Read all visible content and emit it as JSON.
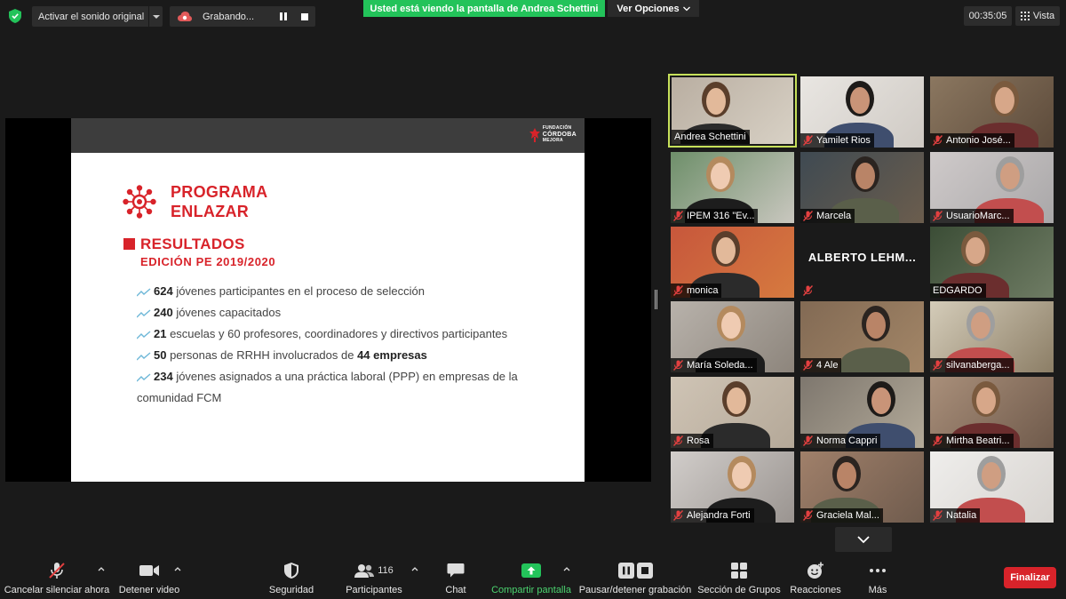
{
  "topbar": {
    "audio_button": "Activar el sonido original",
    "recording_label": "Grabando...",
    "viewing_banner": "Usted está viendo la pantalla de Andrea Schettini",
    "view_options": "Ver Opciones",
    "timer": "00:35:05",
    "view_label": "Vista"
  },
  "slide": {
    "brand_line1": "FUNDACIÓN",
    "brand_line2": "CÓRDOBA",
    "brand_line3": "MEJORA",
    "program_title_1": "PROGRAMA",
    "program_title_2": "ENLAZAR",
    "results_title": "RESULTADOS",
    "results_subtitle": "EDICIÓN PE 2019/2020",
    "bullets": [
      {
        "num": "624",
        "text": " jóvenes participantes en el proceso de selección"
      },
      {
        "num": "240",
        "text": " jóvenes capacitados"
      },
      {
        "num": "21",
        "text": " escuelas y 60 profesores, coordinadores y directivos  participantes"
      },
      {
        "num": "50",
        "text": " personas de RRHH involucrados de ",
        "bold_tail": "44 empresas"
      },
      {
        "num": "234",
        "text": " jóvenes asignados a una práctica laboral (PPP) en empresas de la comunidad FCM"
      }
    ]
  },
  "participants": [
    {
      "name": "Andrea Schettini",
      "muted": false,
      "active": true
    },
    {
      "name": "Yamilet Rios",
      "muted": true
    },
    {
      "name": "Antonio José...",
      "muted": true
    },
    {
      "name": "IPEM 316 \"Ev...",
      "muted": true
    },
    {
      "name": "Marcela",
      "muted": true
    },
    {
      "name": "UsuarioMarc...",
      "muted": true
    },
    {
      "name": "monica",
      "muted": true
    },
    {
      "name": "ALBERTO LEHM...",
      "muted": true,
      "video_off": true
    },
    {
      "name": "EDGARDO",
      "muted": false
    },
    {
      "name": "María Soleda...",
      "muted": true
    },
    {
      "name": "4 Ale",
      "muted": true
    },
    {
      "name": "silvanaberga...",
      "muted": true
    },
    {
      "name": "Rosa",
      "muted": true
    },
    {
      "name": "Norma Cappri",
      "muted": true
    },
    {
      "name": "Mirtha Beatri...",
      "muted": true
    },
    {
      "name": "Alejandra Forti",
      "muted": true
    },
    {
      "name": "Graciela Mal...",
      "muted": true
    },
    {
      "name": "Natalia",
      "muted": true
    }
  ],
  "toolbar": {
    "mute": "Cancelar silenciar ahora",
    "video": "Detener video",
    "security": "Seguridad",
    "participants": "Participantes",
    "participants_count": "116",
    "chat": "Chat",
    "share": "Compartir pantalla",
    "record": "Pausar/detener grabación",
    "breakout": "Sección de Grupos",
    "reactions": "Reacciones",
    "more": "Más",
    "end": "Finalizar"
  },
  "colors": {
    "brand_red": "#d8232a",
    "banner_green": "#23c35a",
    "active_border": "#c6e05a",
    "share_green": "#4bd36f"
  }
}
